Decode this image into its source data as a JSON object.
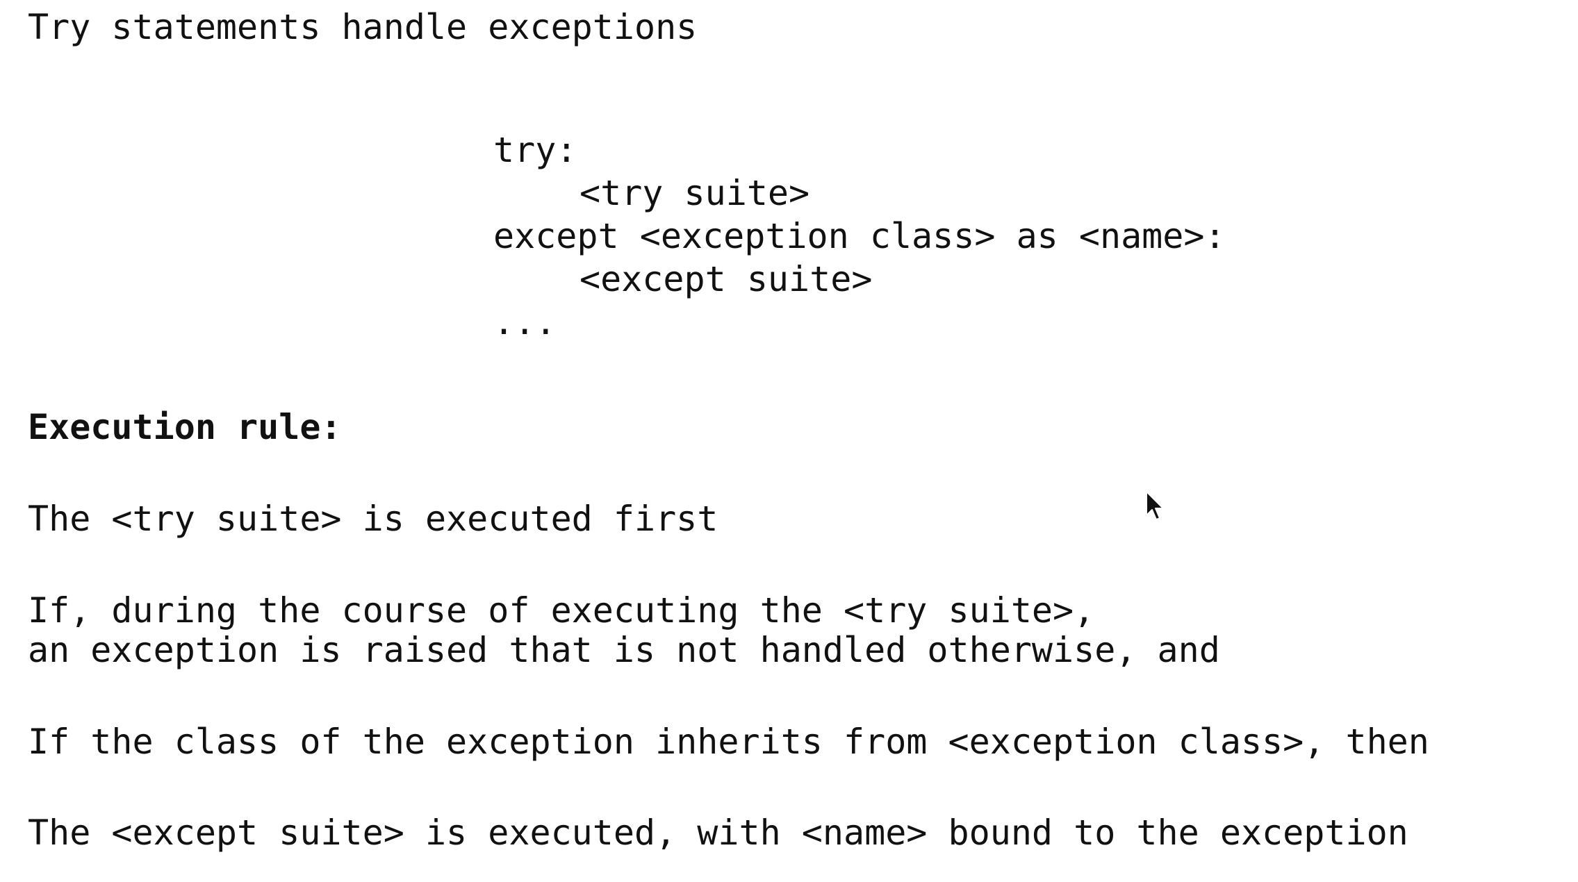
{
  "title": "Try statements handle exceptions",
  "code": {
    "line1": "try:",
    "line2": "<try suite>",
    "line3": "except <exception class> as <name>:",
    "line4": "<except suite>",
    "line5": "..."
  },
  "rule_heading": "Execution rule:",
  "rules": {
    "r1": "The <try suite> is executed first",
    "r2a": "If, during the course of executing the <try suite>,",
    "r2b": "an exception is raised that is not handled otherwise, and",
    "r3": "If the class of the exception inherits from <exception class>, then",
    "r4": "The <except suite> is executed, with <name> bound to the exception"
  },
  "icons": {
    "cursor": "mouse-pointer-icon"
  }
}
